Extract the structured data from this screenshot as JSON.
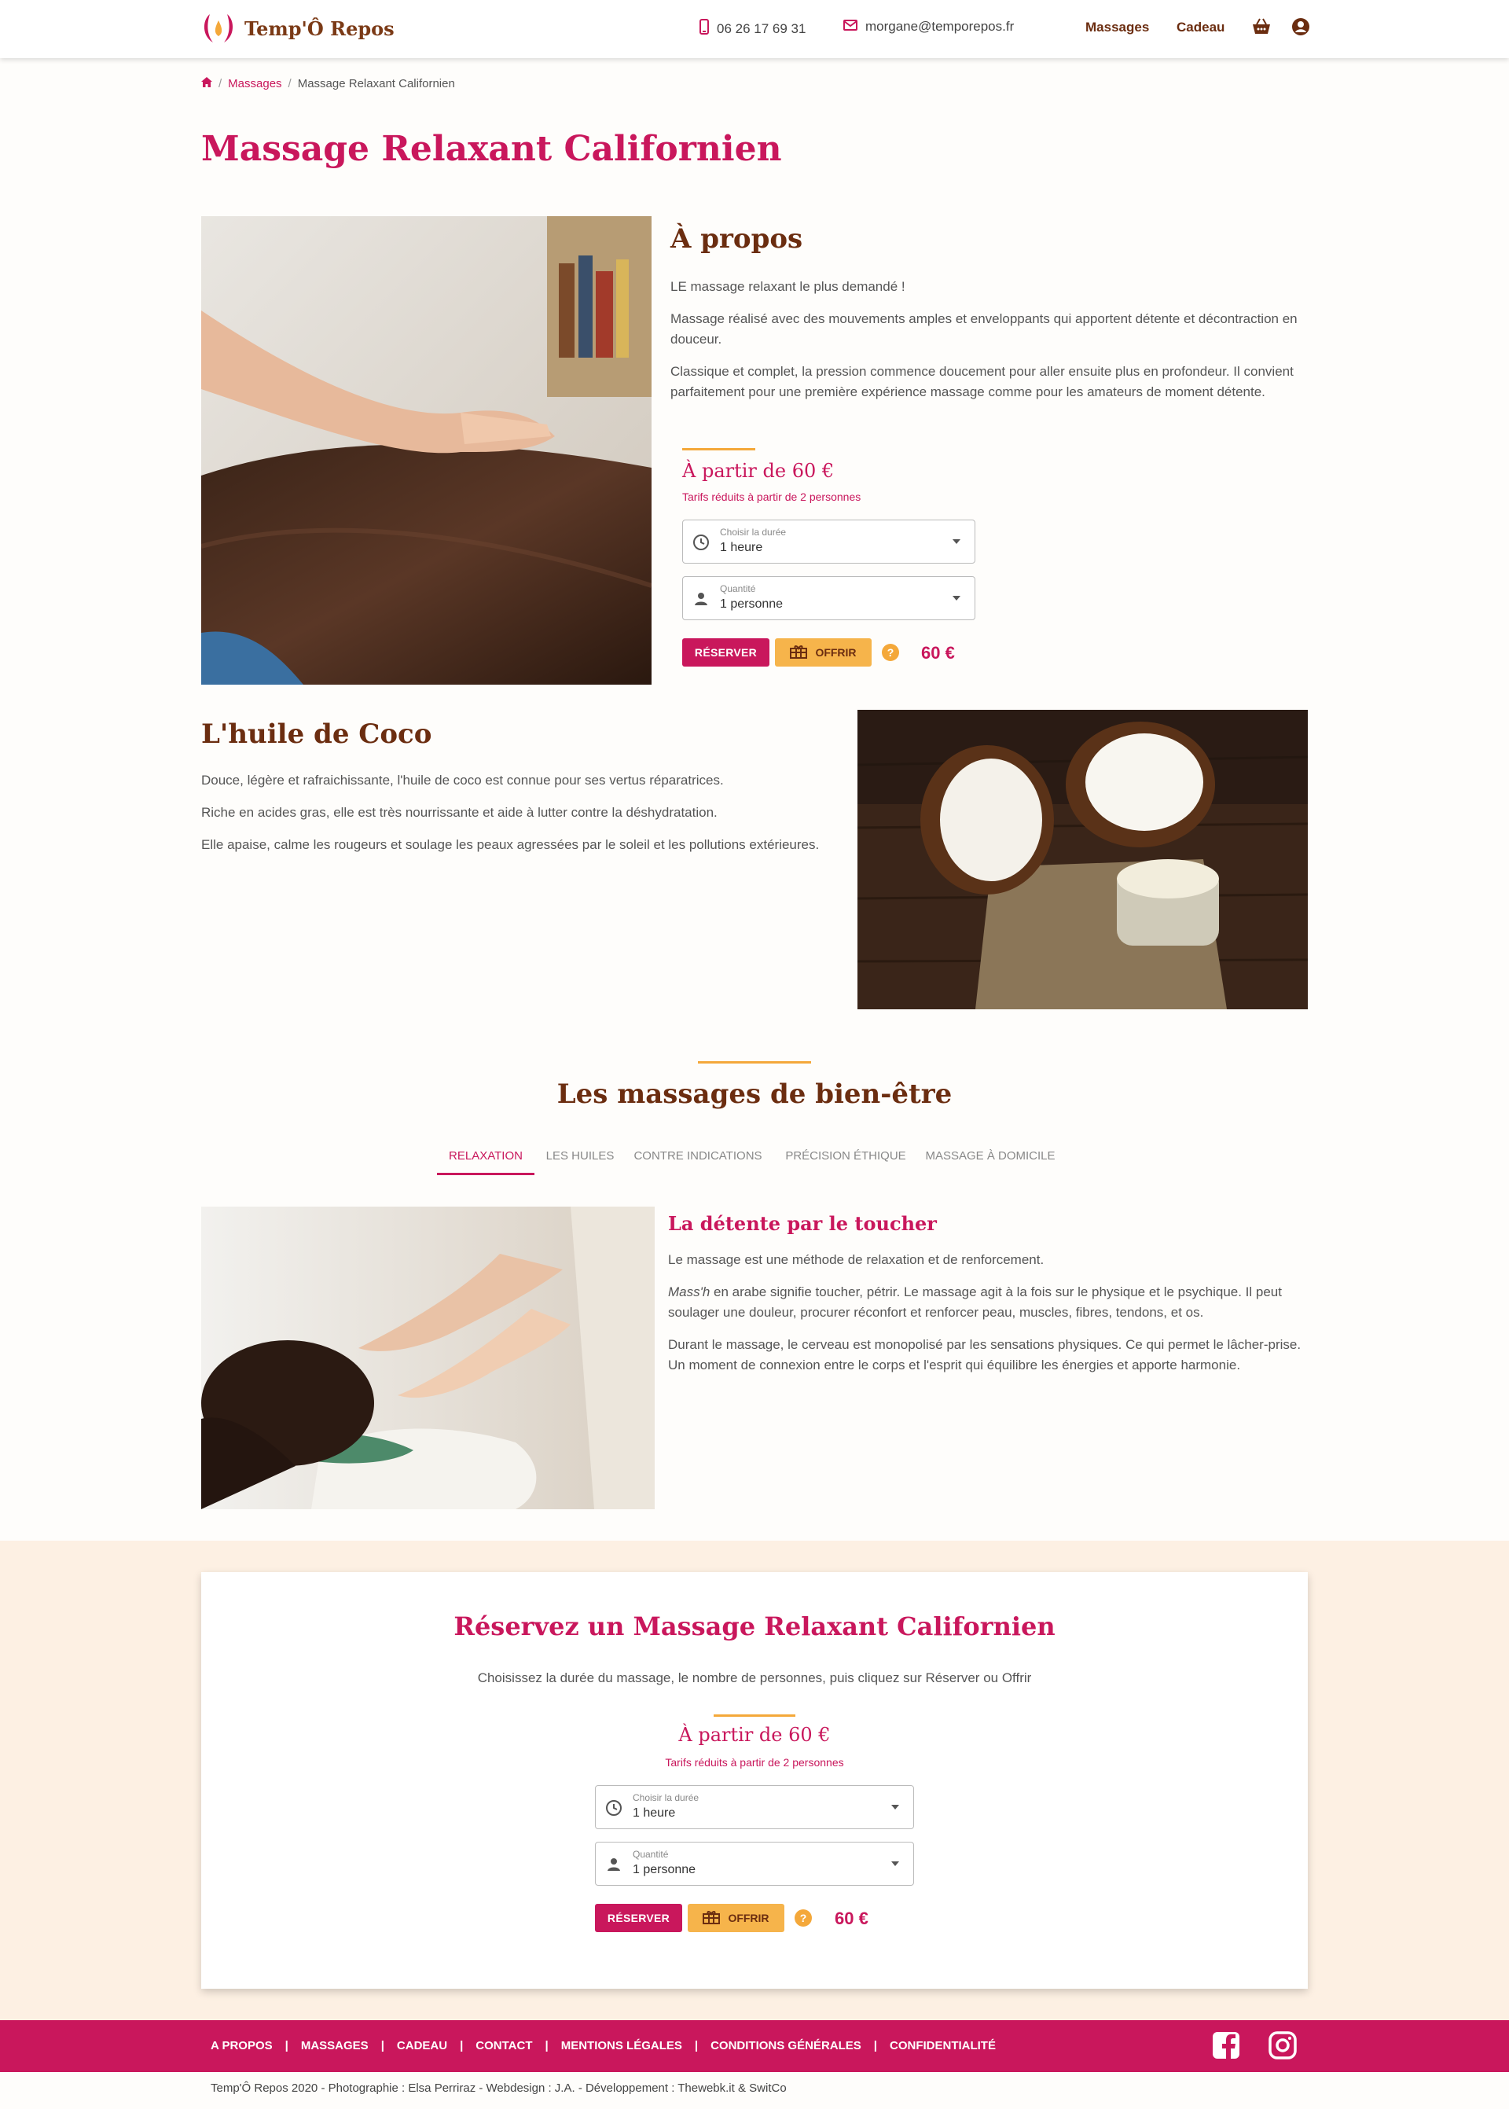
{
  "header": {
    "brand": "Temp'Ô Repos",
    "phone": "06 26 17 69 31",
    "email": "morgane@temporepos.fr",
    "nav": [
      "Massages",
      "Cadeau"
    ]
  },
  "breadcrumb": {
    "level1": "Massages",
    "current": "Massage Relaxant Californien"
  },
  "page_title": "Massage Relaxant Californien",
  "about": {
    "title": "À propos",
    "paragraphs": [
      "LE massage relaxant le plus demandé !",
      "Massage réalisé avec des mouvements amples et enveloppants qui apportent détente et décontraction en douceur.",
      "Classique et complet, la pression commence doucement pour aller ensuite plus en profondeur. Il convient parfaitement pour une première expérience massage comme pour les amateurs de moment détente."
    ]
  },
  "pricing": {
    "from": "À partir de 60 €",
    "note": "Tarifs réduits à partir de 2 personnes",
    "duration_label": "Choisir la durée",
    "duration_value": "1 heure",
    "qty_label": "Quantité",
    "qty_value": "1 personne",
    "reserve": "RÉSERVER",
    "offer": "OFFRIR",
    "help": "?",
    "price": "60 €"
  },
  "oil": {
    "title": "L'huile de Coco",
    "paragraphs": [
      "Douce, légère et rafraichissante, l'huile de coco est connue pour ses vertus réparatrices.",
      "Riche en acides gras, elle est très nourrissante et aide à lutter contre la déshydratation.",
      "Elle apaise, calme les rougeurs et soulage les peaux agressées par le soleil et les pollutions extérieures."
    ]
  },
  "wellbeing": {
    "title": "Les massages de bien-être",
    "tabs": [
      "RELAXATION",
      "LES HUILES",
      "CONTRE INDICATIONS",
      "PRÉCISION ÉTHIQUE",
      "MASSAGE À DOMICILE"
    ],
    "active_tab": "RELAXATION",
    "subtitle": "La détente par le toucher",
    "p1": "Le massage est une méthode de relaxation et de renforcement.",
    "p2_em": "Mass'h",
    "p2_rest": " en arabe signifie toucher, pétrir. Le massage agit à la fois sur le physique et le psychique. Il peut soulager une douleur, procurer réconfort et renforcer peau, muscles, fibres, tendons, et os.",
    "p3": "Durant le massage, le cerveau est monopolisé par les sensations physiques. Ce qui permet le lâcher-prise. Un moment de connexion entre le corps et l'esprit qui équilibre les énergies et apporte harmonie."
  },
  "booking": {
    "title": "Réservez un Massage Relaxant Californien",
    "subtitle": "Choisissez la durée du massage, le nombre de personnes, puis cliquez sur Réserver ou Offrir"
  },
  "footer": {
    "links": [
      "A PROPOS",
      "MASSAGES",
      "CADEAU",
      "CONTACT",
      "MENTIONS LÉGALES",
      "CONDITIONS GÉNÉRALES",
      "CONFIDENTIALITÉ"
    ],
    "separator": "|",
    "credits": "Temp'Ô Repos 2020 - Photographie : Elsa Perriraz - Webdesign : J.A. - Développement : Thewebk.it & SwitCo"
  },
  "colors": {
    "primary": "#c9175c",
    "accent": "#f4a83a",
    "brown": "#6b2d10",
    "cream": "#fdf0e3"
  }
}
